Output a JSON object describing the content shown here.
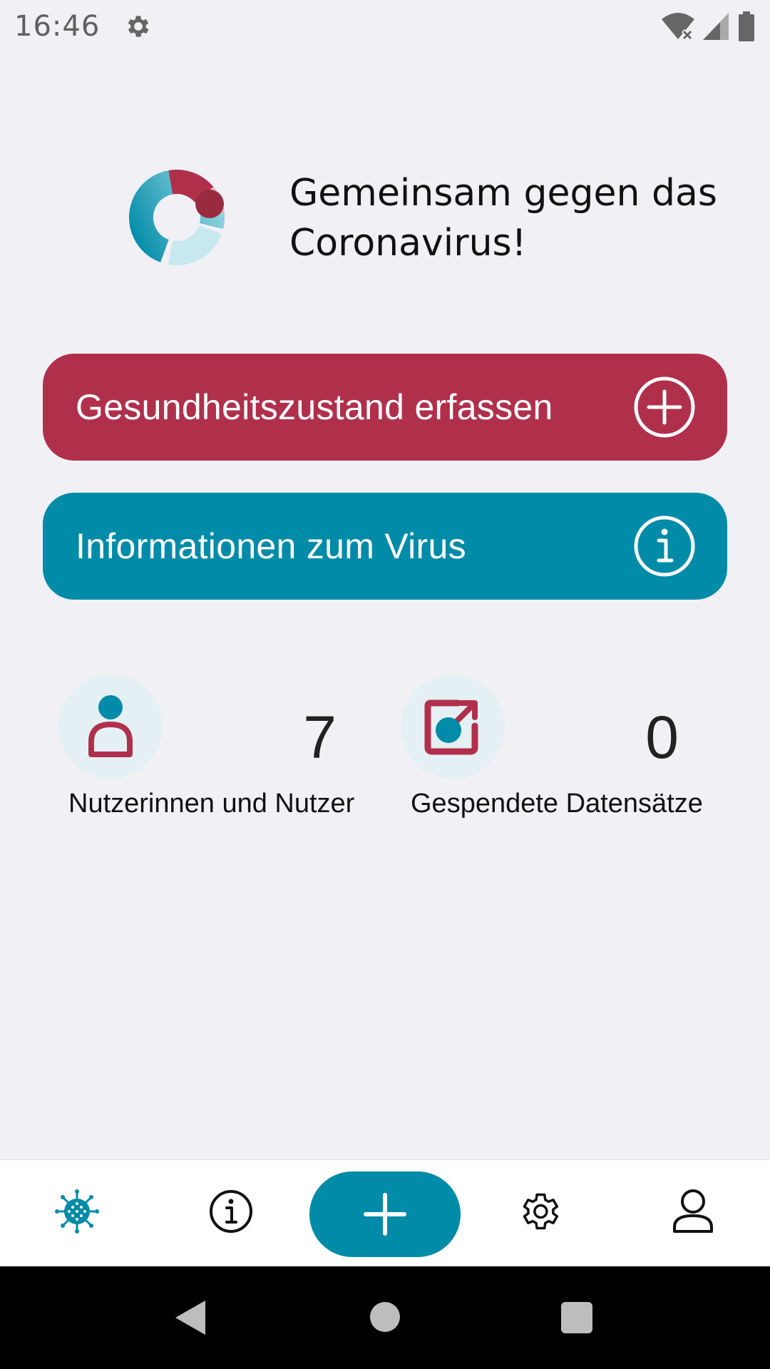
{
  "status_bar": {
    "time": "16:46",
    "icons": [
      "settings-icon",
      "wifi-off-icon",
      "signal-icon",
      "battery-icon"
    ]
  },
  "hero": {
    "title": "Gemeinsam gegen das Coronavirus!",
    "logo": "app-logo"
  },
  "actions": {
    "record_label": "Gesundheitszustand erfassen",
    "record_icon": "plus-circle-icon",
    "info_label": "Informationen zum Virus",
    "info_icon": "info-circle-icon"
  },
  "stats": {
    "users_value": "7",
    "users_label": "Nutzerinnen und Nutzer",
    "donated_value": "0",
    "donated_label": "Gespendete Datensätze"
  },
  "bottom_nav": {
    "items": [
      "virus-icon",
      "info-icon",
      "add-icon",
      "gear-icon",
      "person-icon"
    ],
    "active": "virus-icon"
  },
  "colors": {
    "primary_red": "#b0304c",
    "primary_teal": "#008ba8",
    "background": "#f0f0f5"
  }
}
